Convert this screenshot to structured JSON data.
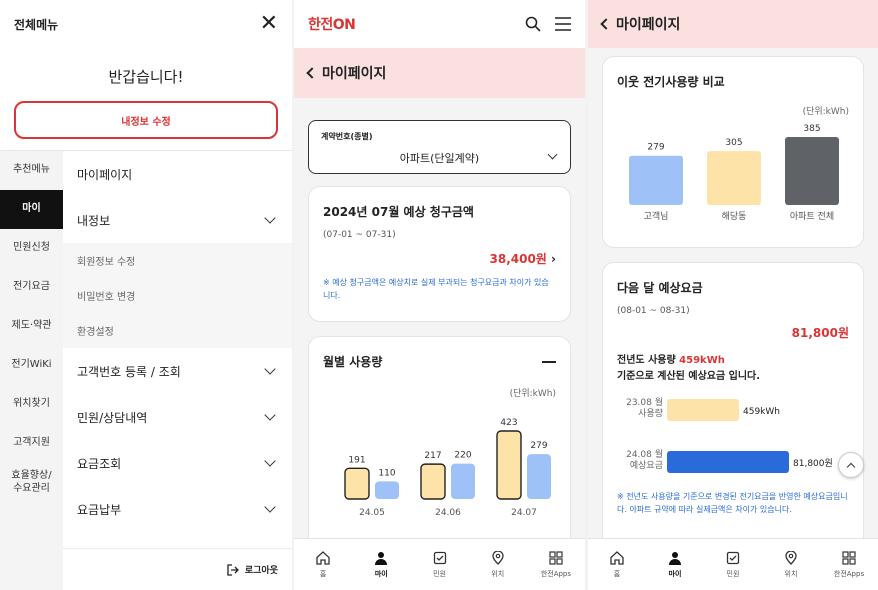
{
  "menu": {
    "title": "전체메뉴",
    "greeting": "반갑습니다!",
    "edit_button": "내정보 수정",
    "left_nav": [
      "추천메뉴",
      "마이",
      "민원신청",
      "전기요금",
      "제도·약관",
      "전기WiKi",
      "위치찾기",
      "고객지원",
      "효율향상/\n수요관리"
    ],
    "right_menu": {
      "mypage": "마이페이지",
      "myinfo": "내정보",
      "sub_items": [
        "회원정보 수정",
        "비밀번호 변경",
        "환경설정"
      ],
      "customer_no": "고객번호 등록 / 조회",
      "complaints": "민원/상담내역",
      "fee_inquiry": "요금조회",
      "fee_payment": "요금납부"
    },
    "logout": "로그아웃"
  },
  "mypage": {
    "logo": "한전ON",
    "page_title": "마이페이지",
    "contract_label": "계약번호(종별)",
    "contract_value": "아파트(단일계약)",
    "bill_title": "2024년 07월 예상 청구금액",
    "bill_range": "(07-01 ~ 07-31)",
    "bill_amount": "38,400원",
    "bill_note": "※ 예상 청구금액은 예상치로 실제 부과되는 청구요금과 차이가 있습니다.",
    "usage_title": "월별 사용량",
    "usage_unit": "(단위:kWh)"
  },
  "chart_data": [
    {
      "type": "bar",
      "categories": [
        "24.05",
        "24.06",
        "24.07"
      ],
      "series": [
        {
          "values": [
            191,
            217,
            423
          ],
          "color": "#fde3a7"
        },
        {
          "values": [
            110,
            220,
            279
          ],
          "color": "#9ec1f7"
        }
      ]
    },
    {
      "type": "bar",
      "title": "이웃 전기사용량 비교",
      "categories": [
        "고객님",
        "해당동",
        "아파트 전체"
      ],
      "values": [
        279,
        305,
        385
      ],
      "colors": [
        "#9ec1f7",
        "#fde3a7",
        "#5f6266"
      ]
    },
    {
      "type": "bar",
      "categories": [
        "23.08 월 사용량",
        "24.08 월 예상요금"
      ],
      "values": [
        459,
        81800
      ],
      "value_labels": [
        "459kWh",
        "81,800원"
      ]
    }
  ],
  "neighbor": {
    "page_title": "마이페이지",
    "title": "이웃 전기사용량 비교",
    "unit": "(단위:kWh)"
  },
  "forecast": {
    "title": "다음 달 예상요금",
    "range": "(08-01 ~ 08-31)",
    "amount": "81,800원",
    "line1_prefix": "전년도 사용량 ",
    "line1_value": "459kWh",
    "line2": "기준으로 계산된 예상요금 입니다.",
    "note": "※ 전년도 사용량을 기준으로 변경된 전기요금을 반영한 예상요금입니다. 아파트 규약에 따라 실제금액은 차이가 있습니다.",
    "bar1_label_line1": "23.08 월",
    "bar1_label_line2": "사용량",
    "bar2_label_line1": "24.08 월",
    "bar2_label_line2": "예상요금"
  },
  "tabs": [
    "홈",
    "마이",
    "민원",
    "위치",
    "한전Apps"
  ]
}
